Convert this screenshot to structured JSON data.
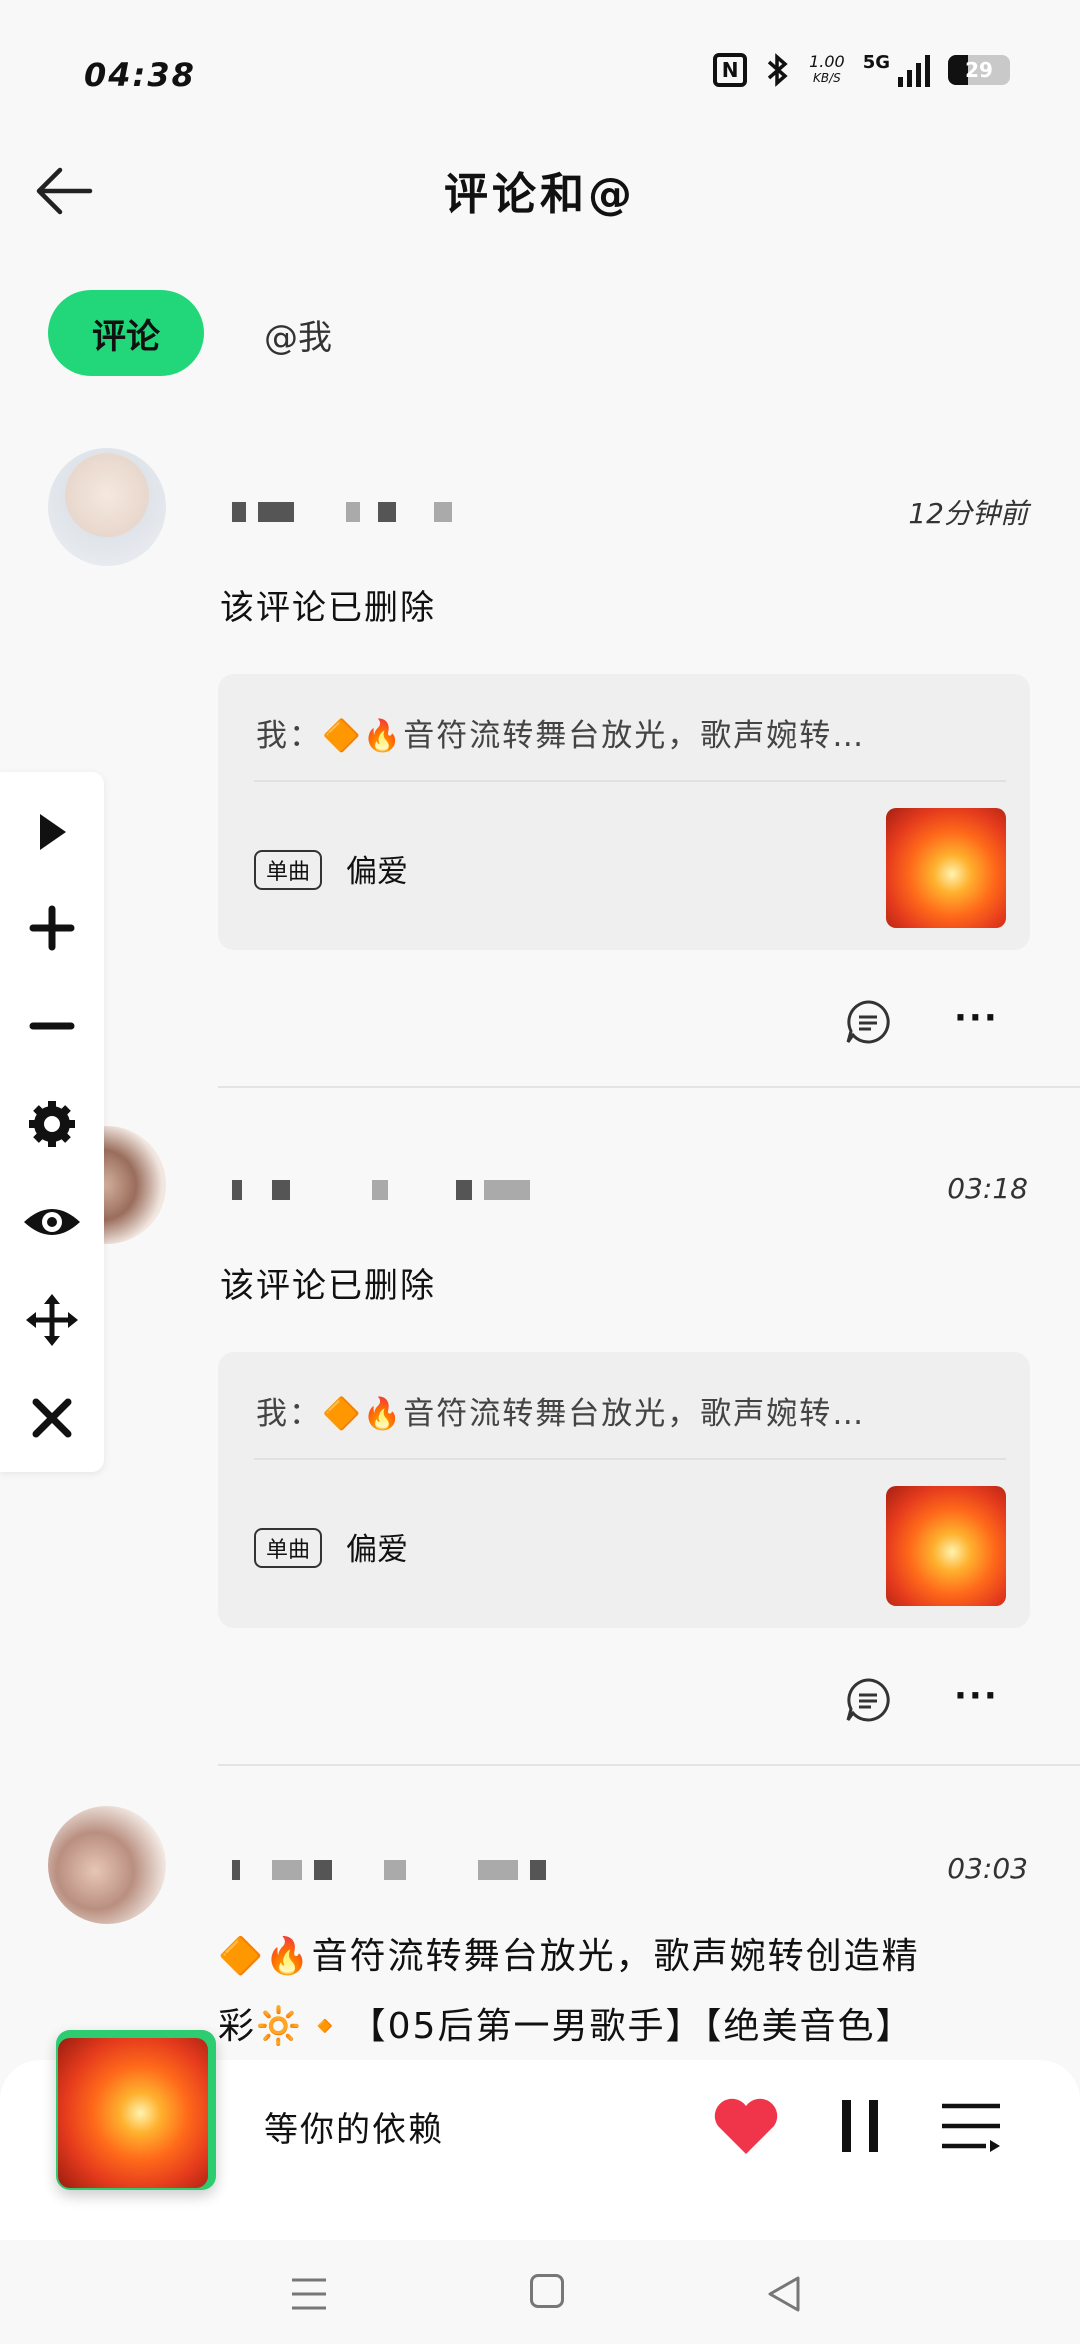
{
  "status_bar": {
    "time": "04:38",
    "nfc": "N",
    "net_speed_value": "1.00",
    "net_speed_unit": "KB/S",
    "network": "5G",
    "battery": "29"
  },
  "header": {
    "title": "评论和@"
  },
  "tabs": [
    {
      "label": "评论",
      "active": true
    },
    {
      "label": "@我",
      "active": false
    }
  ],
  "comments": [
    {
      "time": "12分钟前",
      "text": "该评论已删除",
      "quote": "我：🔶🔥音符流转舞台放光，歌声婉转…",
      "song_tag": "单曲",
      "song_name": "偏爱"
    },
    {
      "time": "03:18",
      "text": "该评论已删除",
      "quote": "我：🔶🔥音符流转舞台放光，歌声婉转…",
      "song_tag": "单曲",
      "song_name": "偏爱"
    },
    {
      "time": "03:03",
      "line1": "🔶🔥音符流转舞台放光，歌声婉转创造精",
      "line2": "彩🔆🔸【05后第一男歌手】【绝美音色】"
    }
  ],
  "player": {
    "title": "等你的依赖"
  },
  "colors": {
    "accent": "#22d67a",
    "heart": "#f0354a"
  }
}
